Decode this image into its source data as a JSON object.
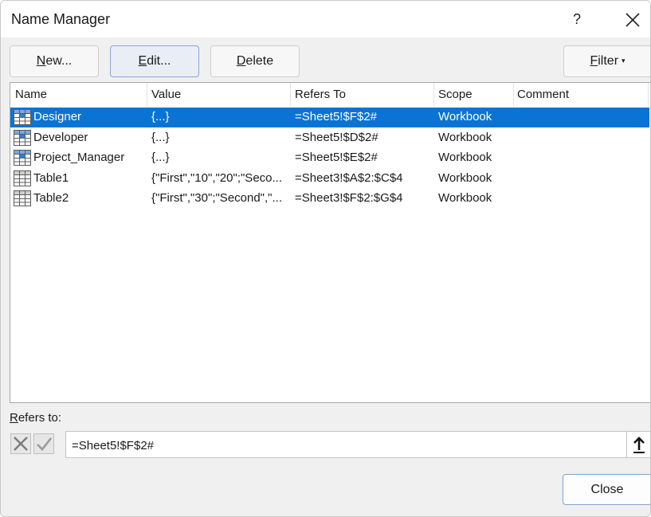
{
  "window": {
    "title": "Name Manager",
    "help_label": "?"
  },
  "toolbar": {
    "new_label_u": "N",
    "new_label_rest": "ew...",
    "edit_label_u": "E",
    "edit_label_rest": "dit...",
    "delete_label_u": "D",
    "delete_label_rest": "elete",
    "filter_label_u": "F",
    "filter_label_rest": "ilter"
  },
  "table": {
    "columns": [
      "Name",
      "Value",
      "Refers To",
      "Scope",
      "Comment"
    ],
    "rows": [
      {
        "icon": "named-range-icon",
        "name": "Designer",
        "value": "{...}",
        "refers_to": "=Sheet5!$F$2#",
        "scope": "Workbook",
        "comment": "",
        "selected": true
      },
      {
        "icon": "named-range-icon",
        "name": "Developer",
        "value": "{...}",
        "refers_to": "=Sheet5!$D$2#",
        "scope": "Workbook",
        "comment": "",
        "selected": false
      },
      {
        "icon": "named-range-icon",
        "name": "Project_Manager",
        "value": "{...}",
        "refers_to": "=Sheet5!$E$2#",
        "scope": "Workbook",
        "comment": "",
        "selected": false
      },
      {
        "icon": "table-icon",
        "name": "Table1",
        "value": "{\"First\",\"10\",\"20\";\"Seco...",
        "refers_to": "=Sheet3!$A$2:$C$4",
        "scope": "Workbook",
        "comment": "",
        "selected": false
      },
      {
        "icon": "table-icon",
        "name": "Table2",
        "value": "{\"First\",\"30\";\"Second\",\"...",
        "refers_to": "=Sheet3!$F$2:$G$4",
        "scope": "Workbook",
        "comment": "",
        "selected": false
      }
    ]
  },
  "refers_to": {
    "label_u": "R",
    "label_rest": "efers to:",
    "value": "=Sheet5!$F$2#"
  },
  "footer": {
    "close_label": "Close"
  },
  "colors": {
    "selection": "#0a74d4",
    "dialog_bg": "#f0f0f0"
  }
}
